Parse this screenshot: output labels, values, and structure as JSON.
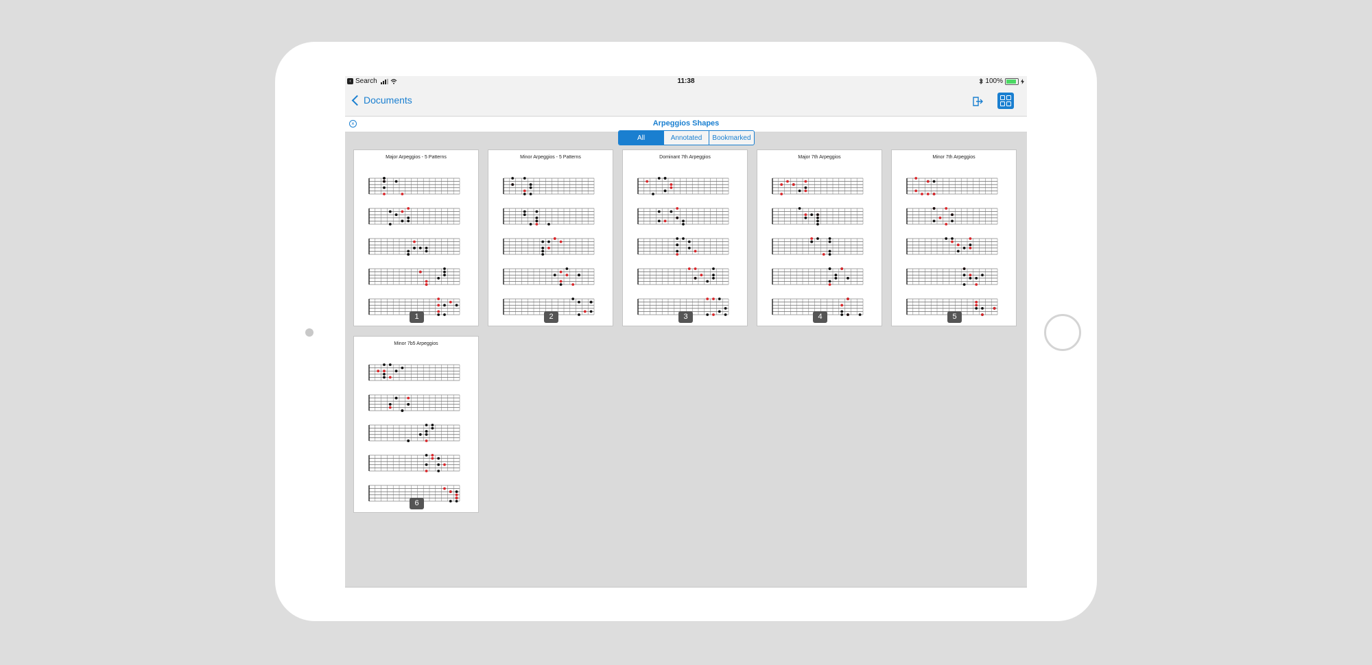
{
  "status_bar": {
    "back_app": "Search",
    "time": "11:38",
    "battery": "100%"
  },
  "nav": {
    "back_label": "Documents"
  },
  "document": {
    "title": "Arpeggios Shapes"
  },
  "filter_tabs": [
    {
      "label": "All",
      "selected": true
    },
    {
      "label": "Annotated",
      "selected": false
    },
    {
      "label": "Bookmarked",
      "selected": false
    }
  ],
  "pages": [
    {
      "number": "1",
      "title": "Major Arpeggios - 5 Patterns"
    },
    {
      "number": "2",
      "title": "Minor Arpeggios - 5 Patterns"
    },
    {
      "number": "3",
      "title": "Dominant 7th Arpeggios"
    },
    {
      "number": "4",
      "title": "Major 7th Arpeggios"
    },
    {
      "number": "5",
      "title": "Minor 7th Arpeggios"
    },
    {
      "number": "6",
      "title": "Minor 7b5 Arpeggios"
    }
  ],
  "colors": {
    "accent": "#1a7fd0",
    "root_note": "#d9262a",
    "note": "#111111"
  }
}
